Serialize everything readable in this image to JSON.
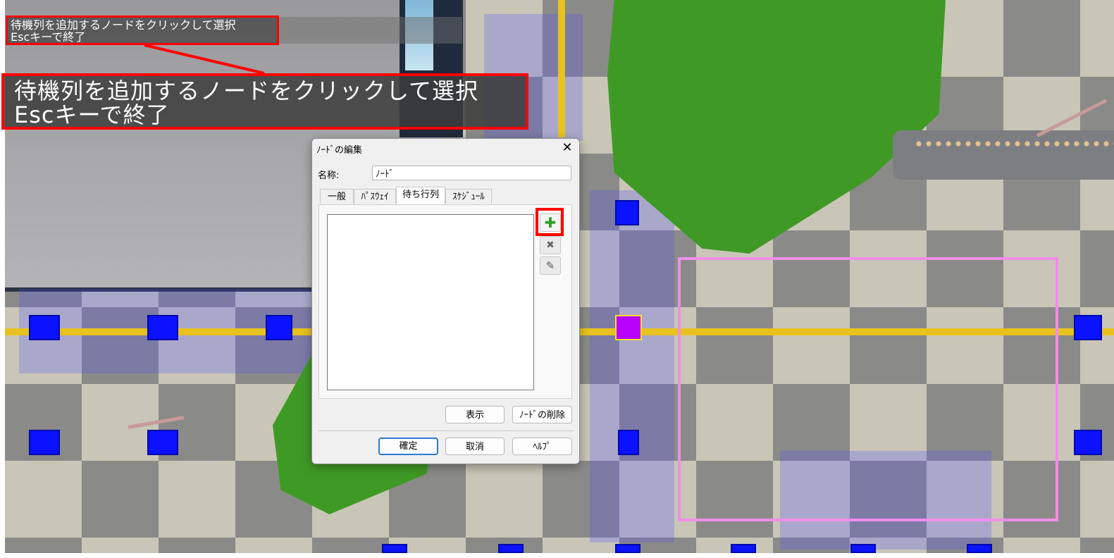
{
  "overlay": {
    "line1": "待機列を追加するノードをクリックして選択",
    "line2": "Escキーで終了"
  },
  "dialog": {
    "title": "ﾉｰﾄﾞの編集",
    "close_glyph": "✕",
    "name_label": "名称:",
    "name_value": "ﾉｰﾄﾞ",
    "tabs": [
      "一般",
      "ﾊﾟｽｳｪｲ",
      "待ち行列",
      "ｽｹｼﾞｭｰﾙ"
    ],
    "active_tab": "待ち行列",
    "side_buttons": {
      "add_glyph": "✚",
      "delete_glyph": "✖",
      "edit_glyph": "✎"
    },
    "buttons": {
      "show": "表示",
      "delete_node": "ﾉｰﾄﾞの削除",
      "ok": "確定",
      "cancel": "取消",
      "help": "ﾍﾙﾌﾟ"
    }
  },
  "colors": {
    "highlight": "#ff0000",
    "node_blue": "#0a12ff",
    "node_selected": "#b700ff",
    "track": "#e8c21f",
    "area_frame": "#f08ee8",
    "add_icon": "#2fa02a"
  },
  "icons": [
    "add-icon",
    "delete-icon",
    "edit-icon",
    "close-icon"
  ]
}
